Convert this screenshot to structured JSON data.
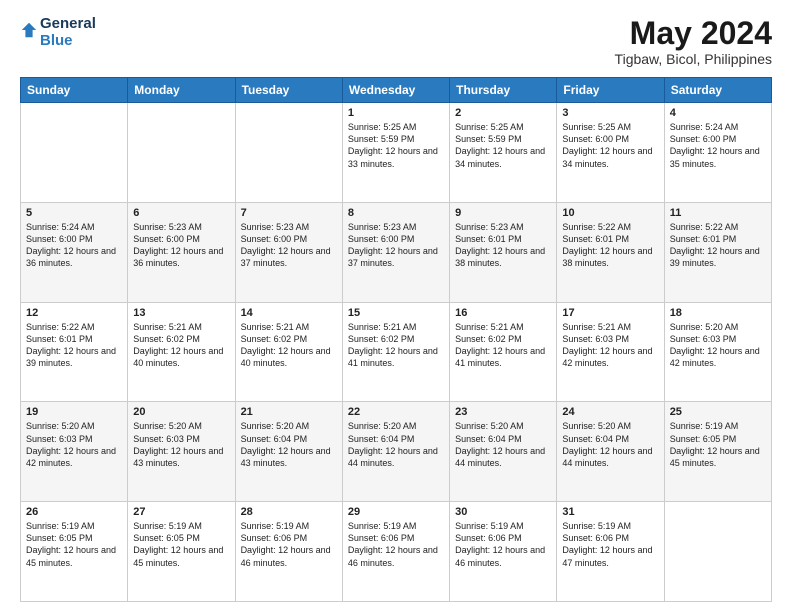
{
  "logo": {
    "line1": "General",
    "line2": "Blue"
  },
  "title": "May 2024",
  "subtitle": "Tigbaw, Bicol, Philippines",
  "days_header": [
    "Sunday",
    "Monday",
    "Tuesday",
    "Wednesday",
    "Thursday",
    "Friday",
    "Saturday"
  ],
  "weeks": [
    [
      {
        "day": "",
        "sunrise": "",
        "sunset": "",
        "daylight": ""
      },
      {
        "day": "",
        "sunrise": "",
        "sunset": "",
        "daylight": ""
      },
      {
        "day": "",
        "sunrise": "",
        "sunset": "",
        "daylight": ""
      },
      {
        "day": "1",
        "sunrise": "Sunrise: 5:25 AM",
        "sunset": "Sunset: 5:59 PM",
        "daylight": "Daylight: 12 hours and 33 minutes."
      },
      {
        "day": "2",
        "sunrise": "Sunrise: 5:25 AM",
        "sunset": "Sunset: 5:59 PM",
        "daylight": "Daylight: 12 hours and 34 minutes."
      },
      {
        "day": "3",
        "sunrise": "Sunrise: 5:25 AM",
        "sunset": "Sunset: 6:00 PM",
        "daylight": "Daylight: 12 hours and 34 minutes."
      },
      {
        "day": "4",
        "sunrise": "Sunrise: 5:24 AM",
        "sunset": "Sunset: 6:00 PM",
        "daylight": "Daylight: 12 hours and 35 minutes."
      }
    ],
    [
      {
        "day": "5",
        "sunrise": "Sunrise: 5:24 AM",
        "sunset": "Sunset: 6:00 PM",
        "daylight": "Daylight: 12 hours and 36 minutes."
      },
      {
        "day": "6",
        "sunrise": "Sunrise: 5:23 AM",
        "sunset": "Sunset: 6:00 PM",
        "daylight": "Daylight: 12 hours and 36 minutes."
      },
      {
        "day": "7",
        "sunrise": "Sunrise: 5:23 AM",
        "sunset": "Sunset: 6:00 PM",
        "daylight": "Daylight: 12 hours and 37 minutes."
      },
      {
        "day": "8",
        "sunrise": "Sunrise: 5:23 AM",
        "sunset": "Sunset: 6:00 PM",
        "daylight": "Daylight: 12 hours and 37 minutes."
      },
      {
        "day": "9",
        "sunrise": "Sunrise: 5:23 AM",
        "sunset": "Sunset: 6:01 PM",
        "daylight": "Daylight: 12 hours and 38 minutes."
      },
      {
        "day": "10",
        "sunrise": "Sunrise: 5:22 AM",
        "sunset": "Sunset: 6:01 PM",
        "daylight": "Daylight: 12 hours and 38 minutes."
      },
      {
        "day": "11",
        "sunrise": "Sunrise: 5:22 AM",
        "sunset": "Sunset: 6:01 PM",
        "daylight": "Daylight: 12 hours and 39 minutes."
      }
    ],
    [
      {
        "day": "12",
        "sunrise": "Sunrise: 5:22 AM",
        "sunset": "Sunset: 6:01 PM",
        "daylight": "Daylight: 12 hours and 39 minutes."
      },
      {
        "day": "13",
        "sunrise": "Sunrise: 5:21 AM",
        "sunset": "Sunset: 6:02 PM",
        "daylight": "Daylight: 12 hours and 40 minutes."
      },
      {
        "day": "14",
        "sunrise": "Sunrise: 5:21 AM",
        "sunset": "Sunset: 6:02 PM",
        "daylight": "Daylight: 12 hours and 40 minutes."
      },
      {
        "day": "15",
        "sunrise": "Sunrise: 5:21 AM",
        "sunset": "Sunset: 6:02 PM",
        "daylight": "Daylight: 12 hours and 41 minutes."
      },
      {
        "day": "16",
        "sunrise": "Sunrise: 5:21 AM",
        "sunset": "Sunset: 6:02 PM",
        "daylight": "Daylight: 12 hours and 41 minutes."
      },
      {
        "day": "17",
        "sunrise": "Sunrise: 5:21 AM",
        "sunset": "Sunset: 6:03 PM",
        "daylight": "Daylight: 12 hours and 42 minutes."
      },
      {
        "day": "18",
        "sunrise": "Sunrise: 5:20 AM",
        "sunset": "Sunset: 6:03 PM",
        "daylight": "Daylight: 12 hours and 42 minutes."
      }
    ],
    [
      {
        "day": "19",
        "sunrise": "Sunrise: 5:20 AM",
        "sunset": "Sunset: 6:03 PM",
        "daylight": "Daylight: 12 hours and 42 minutes."
      },
      {
        "day": "20",
        "sunrise": "Sunrise: 5:20 AM",
        "sunset": "Sunset: 6:03 PM",
        "daylight": "Daylight: 12 hours and 43 minutes."
      },
      {
        "day": "21",
        "sunrise": "Sunrise: 5:20 AM",
        "sunset": "Sunset: 6:04 PM",
        "daylight": "Daylight: 12 hours and 43 minutes."
      },
      {
        "day": "22",
        "sunrise": "Sunrise: 5:20 AM",
        "sunset": "Sunset: 6:04 PM",
        "daylight": "Daylight: 12 hours and 44 minutes."
      },
      {
        "day": "23",
        "sunrise": "Sunrise: 5:20 AM",
        "sunset": "Sunset: 6:04 PM",
        "daylight": "Daylight: 12 hours and 44 minutes."
      },
      {
        "day": "24",
        "sunrise": "Sunrise: 5:20 AM",
        "sunset": "Sunset: 6:04 PM",
        "daylight": "Daylight: 12 hours and 44 minutes."
      },
      {
        "day": "25",
        "sunrise": "Sunrise: 5:19 AM",
        "sunset": "Sunset: 6:05 PM",
        "daylight": "Daylight: 12 hours and 45 minutes."
      }
    ],
    [
      {
        "day": "26",
        "sunrise": "Sunrise: 5:19 AM",
        "sunset": "Sunset: 6:05 PM",
        "daylight": "Daylight: 12 hours and 45 minutes."
      },
      {
        "day": "27",
        "sunrise": "Sunrise: 5:19 AM",
        "sunset": "Sunset: 6:05 PM",
        "daylight": "Daylight: 12 hours and 45 minutes."
      },
      {
        "day": "28",
        "sunrise": "Sunrise: 5:19 AM",
        "sunset": "Sunset: 6:06 PM",
        "daylight": "Daylight: 12 hours and 46 minutes."
      },
      {
        "day": "29",
        "sunrise": "Sunrise: 5:19 AM",
        "sunset": "Sunset: 6:06 PM",
        "daylight": "Daylight: 12 hours and 46 minutes."
      },
      {
        "day": "30",
        "sunrise": "Sunrise: 5:19 AM",
        "sunset": "Sunset: 6:06 PM",
        "daylight": "Daylight: 12 hours and 46 minutes."
      },
      {
        "day": "31",
        "sunrise": "Sunrise: 5:19 AM",
        "sunset": "Sunset: 6:06 PM",
        "daylight": "Daylight: 12 hours and 47 minutes."
      },
      {
        "day": "",
        "sunrise": "",
        "sunset": "",
        "daylight": ""
      }
    ]
  ]
}
